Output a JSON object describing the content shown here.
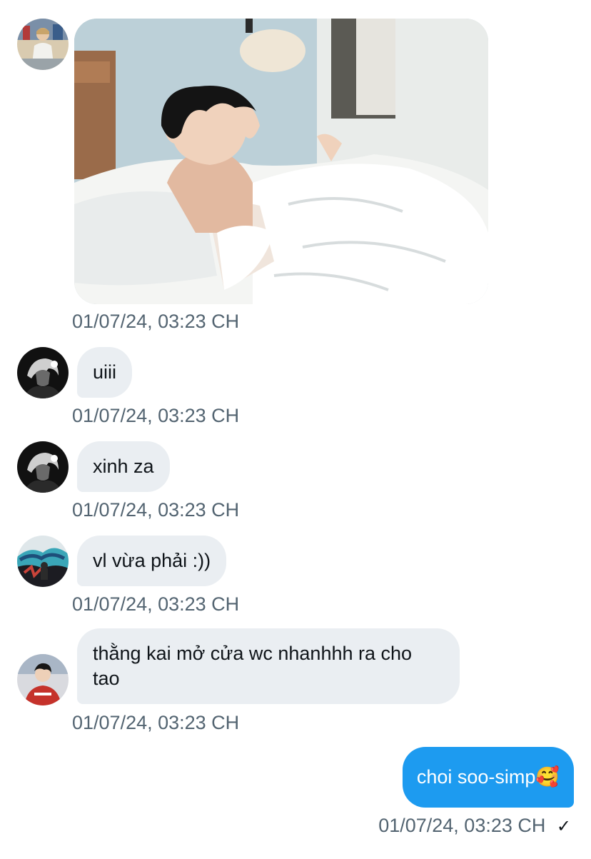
{
  "messages": [
    {
      "type": "image",
      "avatar_icon": "user-avatar-photo",
      "image_icon": "photo-person-in-bed",
      "time": "01/07/24, 03:23 CH"
    },
    {
      "type": "text",
      "avatar_icon": "user-avatar-bw",
      "text": "uiii",
      "time": "01/07/24, 03:23 CH"
    },
    {
      "type": "text",
      "avatar_icon": "user-avatar-bw",
      "text": "xinh za",
      "time": "01/07/24, 03:23 CH"
    },
    {
      "type": "text",
      "avatar_icon": "user-avatar-graffiti",
      "text": "vl vừa phải :))",
      "time": "01/07/24, 03:23 CH"
    },
    {
      "type": "text",
      "avatar_icon": "user-avatar-red-hoodie",
      "text": "thằng kai mở cửa wc nhanhhh ra cho tao",
      "time": "01/07/24, 03:23 CH"
    }
  ],
  "outgoing": {
    "text": "choi soo-simp🥰",
    "time": "01/07/24, 03:23 CH",
    "status_icon": "checkmark-sent",
    "status_glyph": "✓"
  },
  "colors": {
    "incoming_bubble": "#eaeef2",
    "outgoing_bubble": "#1d9bf0",
    "timestamp": "#536471",
    "text": "#0f1419"
  }
}
